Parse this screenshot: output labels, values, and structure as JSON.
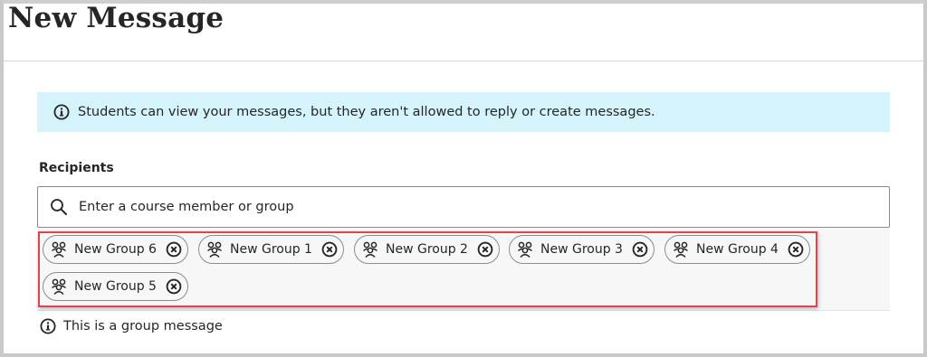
{
  "page": {
    "title": "New Message"
  },
  "notice": {
    "icon": "info-icon",
    "text": "Students can view your messages, but they aren't allowed to reply or create messages."
  },
  "recipients": {
    "label": "Recipients",
    "search": {
      "icon": "search-icon",
      "placeholder": "Enter a course member or group",
      "value": ""
    },
    "chips": [
      {
        "label": "New Group 6",
        "icon": "group-icon",
        "remove_icon": "remove-circle-icon"
      },
      {
        "label": "New Group 1",
        "icon": "group-icon",
        "remove_icon": "remove-circle-icon"
      },
      {
        "label": "New Group 2",
        "icon": "group-icon",
        "remove_icon": "remove-circle-icon"
      },
      {
        "label": "New Group 3",
        "icon": "group-icon",
        "remove_icon": "remove-circle-icon"
      },
      {
        "label": "New Group 4",
        "icon": "group-icon",
        "remove_icon": "remove-circle-icon"
      },
      {
        "label": "New Group 5",
        "icon": "group-icon",
        "remove_icon": "remove-circle-icon"
      }
    ]
  },
  "group_note": {
    "icon": "info-icon",
    "text": "This is a group message"
  },
  "colors": {
    "notice_bg": "#d5f3fa",
    "highlight_border": "#e0444c",
    "text": "#262626"
  }
}
